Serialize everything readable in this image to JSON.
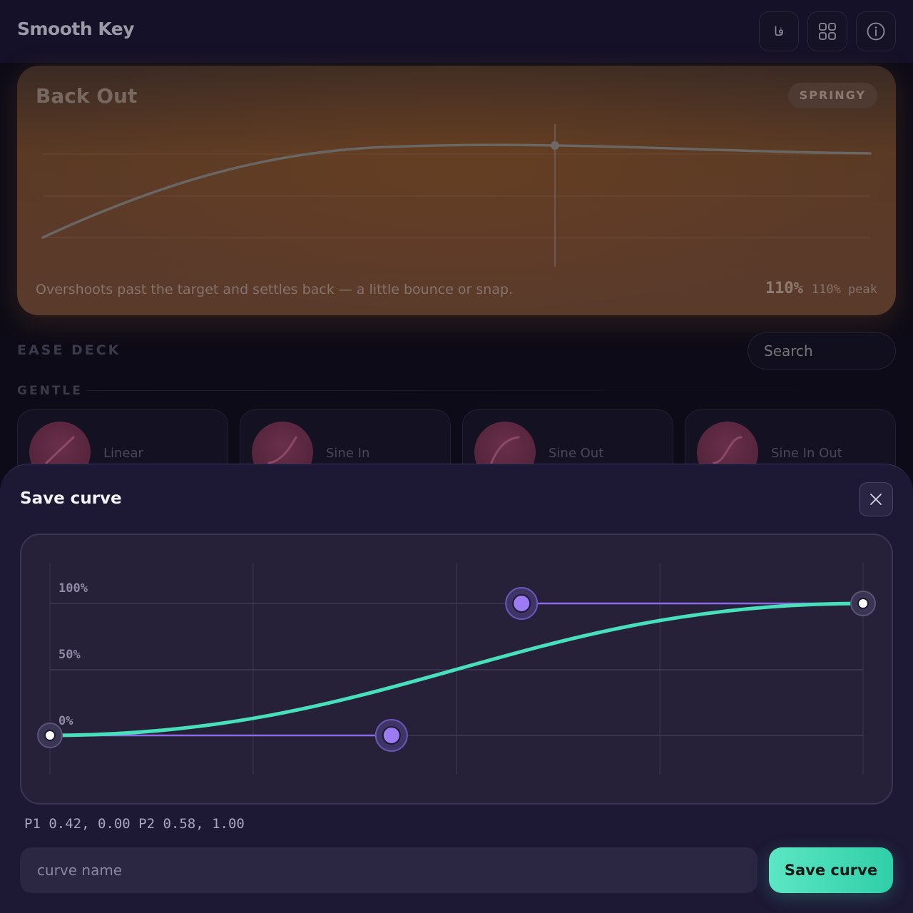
{
  "header": {
    "title": "Smooth Key",
    "buttons": [
      {
        "icon": "language-icon",
        "glyph": "فا"
      },
      {
        "icon": "grid-icon"
      },
      {
        "icon": "info-icon"
      }
    ]
  },
  "hero": {
    "title": "Back Out",
    "badge": "SPRINGY",
    "description": "Overshoots past the target and settles back — a little bounce or snap.",
    "peak_value": "110%",
    "peak_label": "110% peak"
  },
  "deck": {
    "title": "EASE DECK",
    "search_placeholder": "Search",
    "group": "GENTLE",
    "cards": [
      {
        "label": "Linear"
      },
      {
        "label": "Sine In"
      },
      {
        "label": "Sine Out"
      },
      {
        "label": "Sine In Out"
      }
    ]
  },
  "sheet": {
    "title": "Save curve",
    "axis": {
      "label_100": "100%",
      "label_50": "50%",
      "label_0": "0%"
    },
    "p1": [
      0.42,
      0.0
    ],
    "p2": [
      0.58,
      1.0
    ],
    "coords_text": "P1 0.42, 0.00 P2 0.58, 1.00",
    "name_placeholder": "curve name",
    "save_label": "Save curve"
  },
  "colors": {
    "accent": "#47e0bb",
    "handle": "#9b7cf2",
    "hero_bg": "#5a3a24"
  }
}
